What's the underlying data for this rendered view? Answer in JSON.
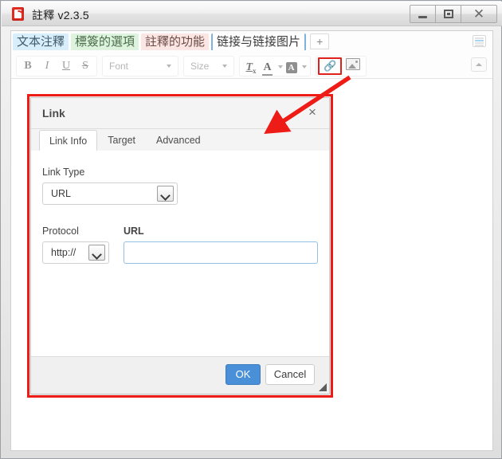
{
  "window": {
    "title": "註釋 v2.3.5",
    "icon": "app-red-book-icon",
    "controls": {
      "minimize": "minimize-button",
      "maximize": "maximize-button",
      "close": "close-button"
    }
  },
  "doc_tabs": {
    "items": [
      {
        "label": "文本注釋",
        "color": "#d9eefb",
        "active": false
      },
      {
        "label": "標簽的選項",
        "color": "#ddf3dd",
        "active": false
      },
      {
        "label": "註釋的功能",
        "color": "#fce6e3",
        "active": false
      },
      {
        "label": "链接与链接图片",
        "color": "#ffffff",
        "active": true
      }
    ],
    "add_label": "+",
    "rows_icon": "list-rows-icon"
  },
  "toolbar": {
    "bold": "B",
    "italic": "I",
    "underline": "U",
    "strike": "S",
    "font_placeholder": "Font",
    "size_placeholder": "Size",
    "remove_format": "Tx",
    "text_color": "A",
    "bg_color": "A",
    "link_icon": "link-icon",
    "image_icon": "image-icon",
    "collapse_icon": "collapse-toolbar-icon",
    "link_highlight_color": "#e0211b"
  },
  "dialog": {
    "title": "Link",
    "close_label": "×",
    "tabs": [
      {
        "label": "Link Info",
        "active": true
      },
      {
        "label": "Target",
        "active": false
      },
      {
        "label": "Advanced",
        "active": false
      }
    ],
    "link_type": {
      "label": "Link Type",
      "value": "URL"
    },
    "protocol": {
      "label": "Protocol",
      "value": "http://"
    },
    "url": {
      "label": "URL",
      "value": "",
      "placeholder": ""
    },
    "ok_label": "OK",
    "cancel_label": "Cancel",
    "ok_color": "#4a90d9"
  },
  "annotation": {
    "box_color": "#ee1c16",
    "arrow_color": "#ee1c16",
    "arrow_from": "link-toolbar-button",
    "arrow_to": "link-dialog"
  }
}
